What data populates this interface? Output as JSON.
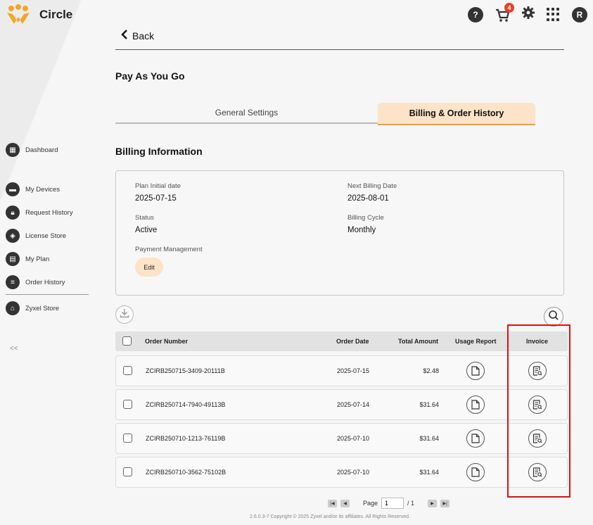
{
  "app": {
    "name": "Circle"
  },
  "topbar": {
    "cart_count": "4",
    "avatar_initial": "R",
    "help_glyph": "?"
  },
  "sidebar": {
    "items": [
      {
        "label": "Dashboard",
        "icon": "dashboard-icon"
      },
      {
        "label": "My Devices",
        "icon": "devices-icon"
      },
      {
        "label": "Request History",
        "icon": "lock-icon"
      },
      {
        "label": "License Store",
        "icon": "license-icon"
      },
      {
        "label": "My Plan",
        "icon": "calendar-icon"
      },
      {
        "label": "Order History",
        "icon": "list-icon"
      },
      {
        "label": "Zyxel Store",
        "icon": "store-icon"
      }
    ],
    "collapse_label": "<<"
  },
  "header": {
    "back_label": "Back",
    "page_title": "Pay As You Go"
  },
  "tabs": [
    {
      "label": "General Settings",
      "active": false
    },
    {
      "label": "Billing & Order History",
      "active": true
    }
  ],
  "billing": {
    "section_title": "Billing Information",
    "plan_initial_date_label": "Plan Initial date",
    "plan_initial_date": "2025-07-15",
    "next_billing_date_label": "Next Billing Date",
    "next_billing_date": "2025-08-01",
    "status_label": "Status",
    "status": "Active",
    "billing_cycle_label": "Billing Cycle",
    "billing_cycle": "Monthly",
    "payment_management_label": "Payment Management",
    "edit_label": "Edit"
  },
  "table": {
    "columns": [
      "Order Number",
      "Order Date",
      "Total Amount",
      "Usage Report",
      "Invoice"
    ],
    "rows": [
      {
        "order_number": "ZCIRB250715-3409-20111B",
        "order_date": "2025-07-15",
        "total": "$2.48"
      },
      {
        "order_number": "ZCIRB250714-7940-49113B",
        "order_date": "2025-07-14",
        "total": "$31.64"
      },
      {
        "order_number": "ZCIRB250710-1213-76119B",
        "order_date": "2025-07-10",
        "total": "$31.64"
      },
      {
        "order_number": "ZCIRB250710-3562-75102B",
        "order_date": "2025-07-10",
        "total": "$31.64"
      }
    ]
  },
  "pagination": {
    "page_label": "Page",
    "current": "1",
    "total_label": "/ 1"
  },
  "footer": {
    "text": "2.6.0.3-7 Copyright © 2025 Zyxel and/or its affiliates. All Rights Reserved."
  },
  "colors": {
    "accent": "#f09b3d",
    "accent_light": "#fde3c7",
    "highlight": "#e01010"
  }
}
